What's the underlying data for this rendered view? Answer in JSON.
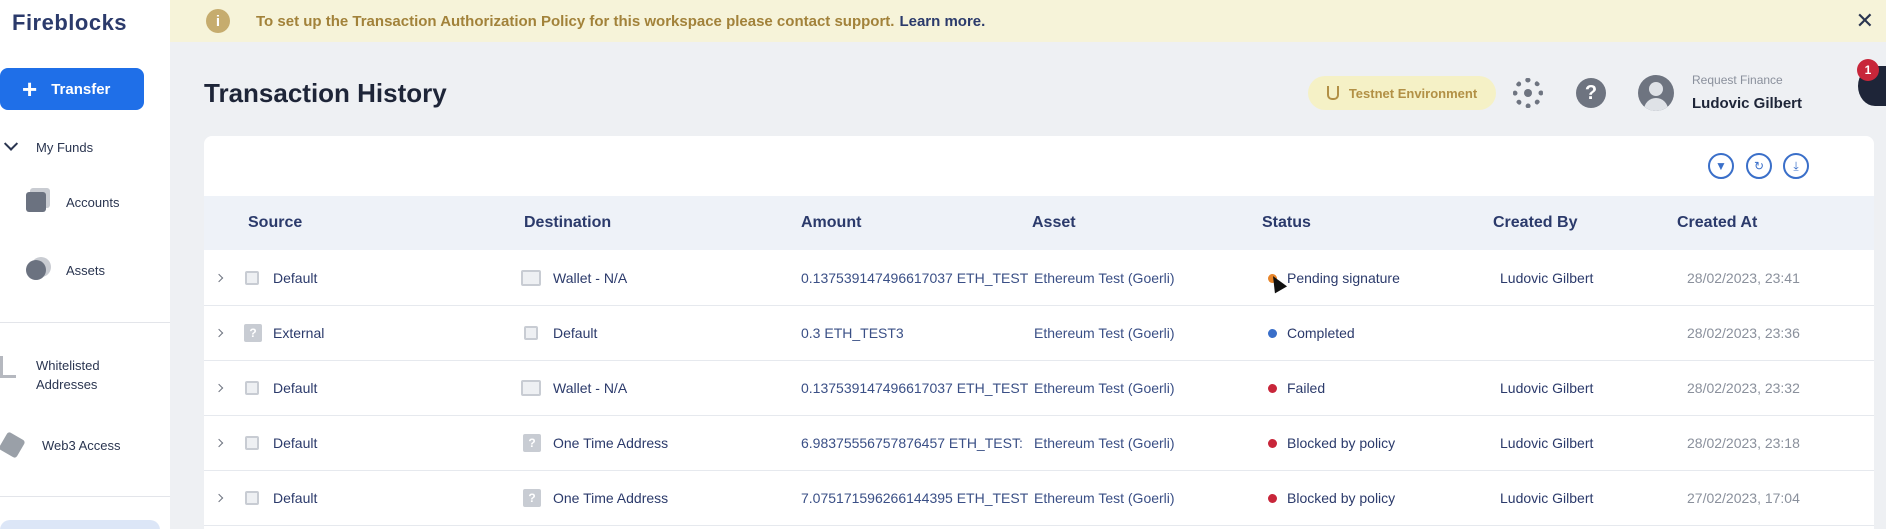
{
  "sidebar": {
    "logo": "Fireblocks",
    "transfer_label": "Transfer",
    "my_funds": "My Funds",
    "items": [
      {
        "label": "Accounts"
      },
      {
        "label": "Assets"
      },
      {
        "label_line1": "Whitelisted",
        "label_line2": "Addresses"
      },
      {
        "label": "Web3 Access"
      }
    ]
  },
  "banner": {
    "text": "To set up the Transaction Authorization Policy for this workspace please contact support.",
    "link": "Learn more.",
    "close": "✕"
  },
  "header": {
    "title": "Transaction History",
    "environment": "Testnet Environment",
    "org": "Request Finance",
    "user": "Ludovic Gilbert",
    "notifications": "1"
  },
  "table": {
    "columns": [
      "Source",
      "Destination",
      "Amount",
      "Asset",
      "Status",
      "Created By",
      "Created At"
    ],
    "rows": [
      {
        "source": "Default",
        "source_icon": "vault-icon",
        "destination": "Wallet - N/A",
        "destination_icon": "wallet-icon",
        "amount": "0.137539147496617037 ETH_TEST",
        "asset": "Ethereum Test (Goerli)",
        "status": "Pending signature",
        "status_color": "#e8862b",
        "created_by": "Ludovic Gilbert",
        "created_at": "28/02/2023, 23:41"
      },
      {
        "source": "External",
        "source_icon": "unknown-icon",
        "destination": "Default",
        "destination_icon": "vault-icon",
        "amount": "0.3 ETH_TEST3",
        "asset": "Ethereum Test (Goerli)",
        "status": "Completed",
        "status_color": "#3a6fc9",
        "created_by": "",
        "created_at": "28/02/2023, 23:36"
      },
      {
        "source": "Default",
        "source_icon": "vault-icon",
        "destination": "Wallet - N/A",
        "destination_icon": "wallet-icon",
        "amount": "0.137539147496617037 ETH_TEST",
        "asset": "Ethereum Test (Goerli)",
        "status": "Failed",
        "status_color": "#c8263a",
        "created_by": "Ludovic Gilbert",
        "created_at": "28/02/2023, 23:32"
      },
      {
        "source": "Default",
        "source_icon": "vault-icon",
        "destination": "One Time Address",
        "destination_icon": "unknown-icon",
        "amount": "6.98375556757876457 ETH_TEST:",
        "asset": "Ethereum Test (Goerli)",
        "status": "Blocked by policy",
        "status_color": "#c8263a",
        "created_by": "Ludovic Gilbert",
        "created_at": "28/02/2023, 23:18"
      },
      {
        "source": "Default",
        "source_icon": "vault-icon",
        "destination": "One Time Address",
        "destination_icon": "unknown-icon",
        "amount": "7.075171596266144395 ETH_TEST",
        "asset": "Ethereum Test (Goerli)",
        "status": "Blocked by policy",
        "status_color": "#c8263a",
        "created_by": "Ludovic Gilbert",
        "created_at": "27/02/2023, 17:04"
      }
    ]
  }
}
